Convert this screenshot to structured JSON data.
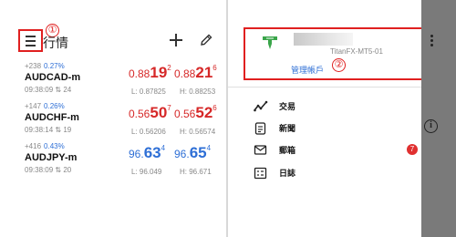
{
  "header": {
    "title": "行情",
    "annotation": "①"
  },
  "quotes": [
    {
      "change_points": "+238",
      "change_percent": "0.27%",
      "symbol": "AUDCAD-m",
      "time": "09:38:09",
      "spread": "24",
      "bid": {
        "pre": "0.88",
        "big": "19",
        "sup": "2"
      },
      "ask": {
        "pre": "0.88",
        "big": "21",
        "sup": "6"
      },
      "low": "L: 0.87825",
      "high": "H: 0.88253",
      "color": "#d62828"
    },
    {
      "change_points": "+147",
      "change_percent": "0.26%",
      "symbol": "AUDCHF-m",
      "time": "09:38:14",
      "spread": "19",
      "bid": {
        "pre": "0.56",
        "big": "50",
        "sup": "7"
      },
      "ask": {
        "pre": "0.56",
        "big": "52",
        "sup": "6"
      },
      "low": "L: 0.56206",
      "high": "H: 0.56574",
      "color": "#d62828"
    },
    {
      "change_points": "+416",
      "change_percent": "0.43%",
      "symbol": "AUDJPY-m",
      "time": "09:38:09",
      "spread": "20",
      "bid": {
        "pre": "96.",
        "big": "63",
        "sup": "4"
      },
      "ask": {
        "pre": "96.",
        "big": "65",
        "sup": "4"
      },
      "low": "L: 96.049",
      "high": "H: 96.671",
      "color": "#2e6fd6"
    }
  ],
  "account": {
    "server": "TitanFX-MT5-01",
    "manage_label": "管理帳戶",
    "annotation": "②"
  },
  "menu": [
    {
      "label": "交易",
      "icon": "trade-chart-icon"
    },
    {
      "label": "新聞",
      "icon": "news-icon"
    },
    {
      "label": "郵箱",
      "icon": "mail-icon",
      "badge": "7"
    },
    {
      "label": "日誌",
      "icon": "journal-icon"
    }
  ],
  "overlay": {
    "info_glyph": "i"
  }
}
